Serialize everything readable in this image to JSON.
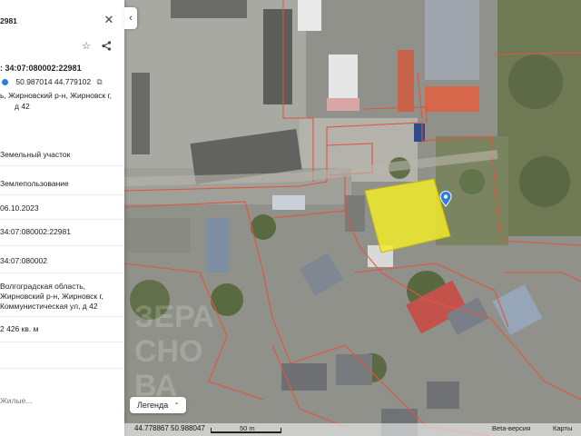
{
  "panel": {
    "id_fragment": "2981",
    "cadastral_heading": "34:07:080002:22981",
    "coordinates": "50.987014 44.779102",
    "address_short": "ь, Жирновский р-н, Жирновск г,",
    "address_short2": "д 42",
    "rows": [
      {
        "value": "Земельный участок"
      },
      {
        "value": "Землепользование"
      },
      {
        "value": "06.10.2023"
      },
      {
        "value": "34:07:080002:22981"
      },
      {
        "value": "34:07:080002"
      },
      {
        "value": "Волгоградская область,"
      },
      {
        "value": "Жирновский р-н, Жирновск г,"
      },
      {
        "value": "Коммунистическая ул, д 42"
      },
      {
        "value": "2 426 кв. м"
      }
    ],
    "partial_bottom": "Жилые..."
  },
  "map": {
    "legend_label": "Легенда",
    "bottom_coords": "44.778867  50.988047",
    "scale_label": "50 m",
    "beta_label": "Beta-версия",
    "maps_label": "Карты",
    "watermark": "ЗЕРА СНОВА",
    "colors": {
      "selected_parcel": "#f2ea2a",
      "parcel_border": "#e2553c",
      "marker": "#2a7de1"
    }
  }
}
